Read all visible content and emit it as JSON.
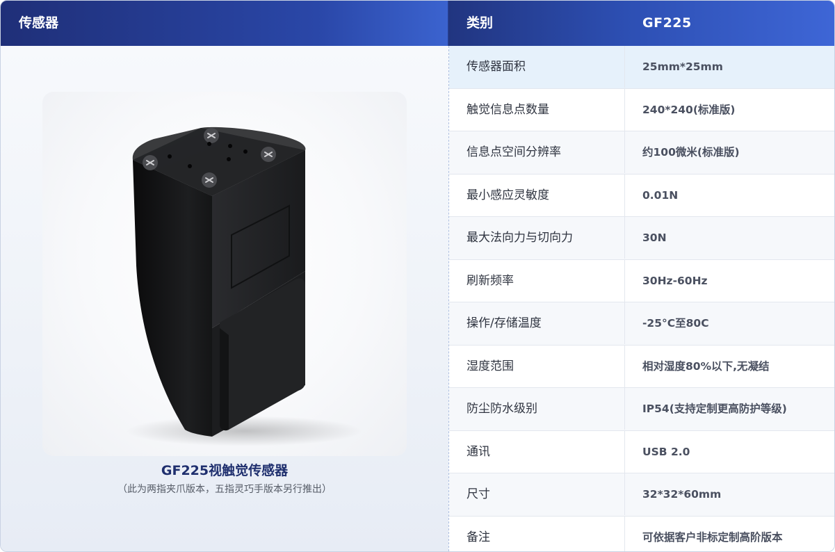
{
  "header": {
    "sensor_label": "传感器",
    "category_label": "类别",
    "model_label": "GF225"
  },
  "product": {
    "title": "GF225视触觉传感器",
    "note": "（此为两指夹爪版本，五指灵巧手版本另行推出）"
  },
  "specs": [
    {
      "label": "传感器面积",
      "value": "25mm*25mm"
    },
    {
      "label": "触觉信息点数量",
      "value": "240*240(标准版)"
    },
    {
      "label": "信息点空间分辨率",
      "value": "约100微米(标准版)"
    },
    {
      "label": "最小感应灵敏度",
      "value": "0.01N"
    },
    {
      "label": "最大法向力与切向力",
      "value": "30N"
    },
    {
      "label": "刷新频率",
      "value": "30Hz-60Hz"
    },
    {
      "label": "操作/存储温度",
      "value": "-25°C至80C"
    },
    {
      "label": "湿度范围",
      "value": "相对湿度80%以下,无凝结"
    },
    {
      "label": "防尘防水级别",
      "value": "IP54(支持定制更高防护等级)"
    },
    {
      "label": "通讯",
      "value": "USB 2.0"
    },
    {
      "label": "尺寸",
      "value": "32*32*60mm"
    },
    {
      "label": "备注",
      "value": "可依据客户非标定制高阶版本"
    }
  ],
  "colors": {
    "header_start": "#1f2f78",
    "header_end": "#3e66d6",
    "title_text": "#1f2f6e",
    "first_row_bg": "#e6f1fb"
  }
}
